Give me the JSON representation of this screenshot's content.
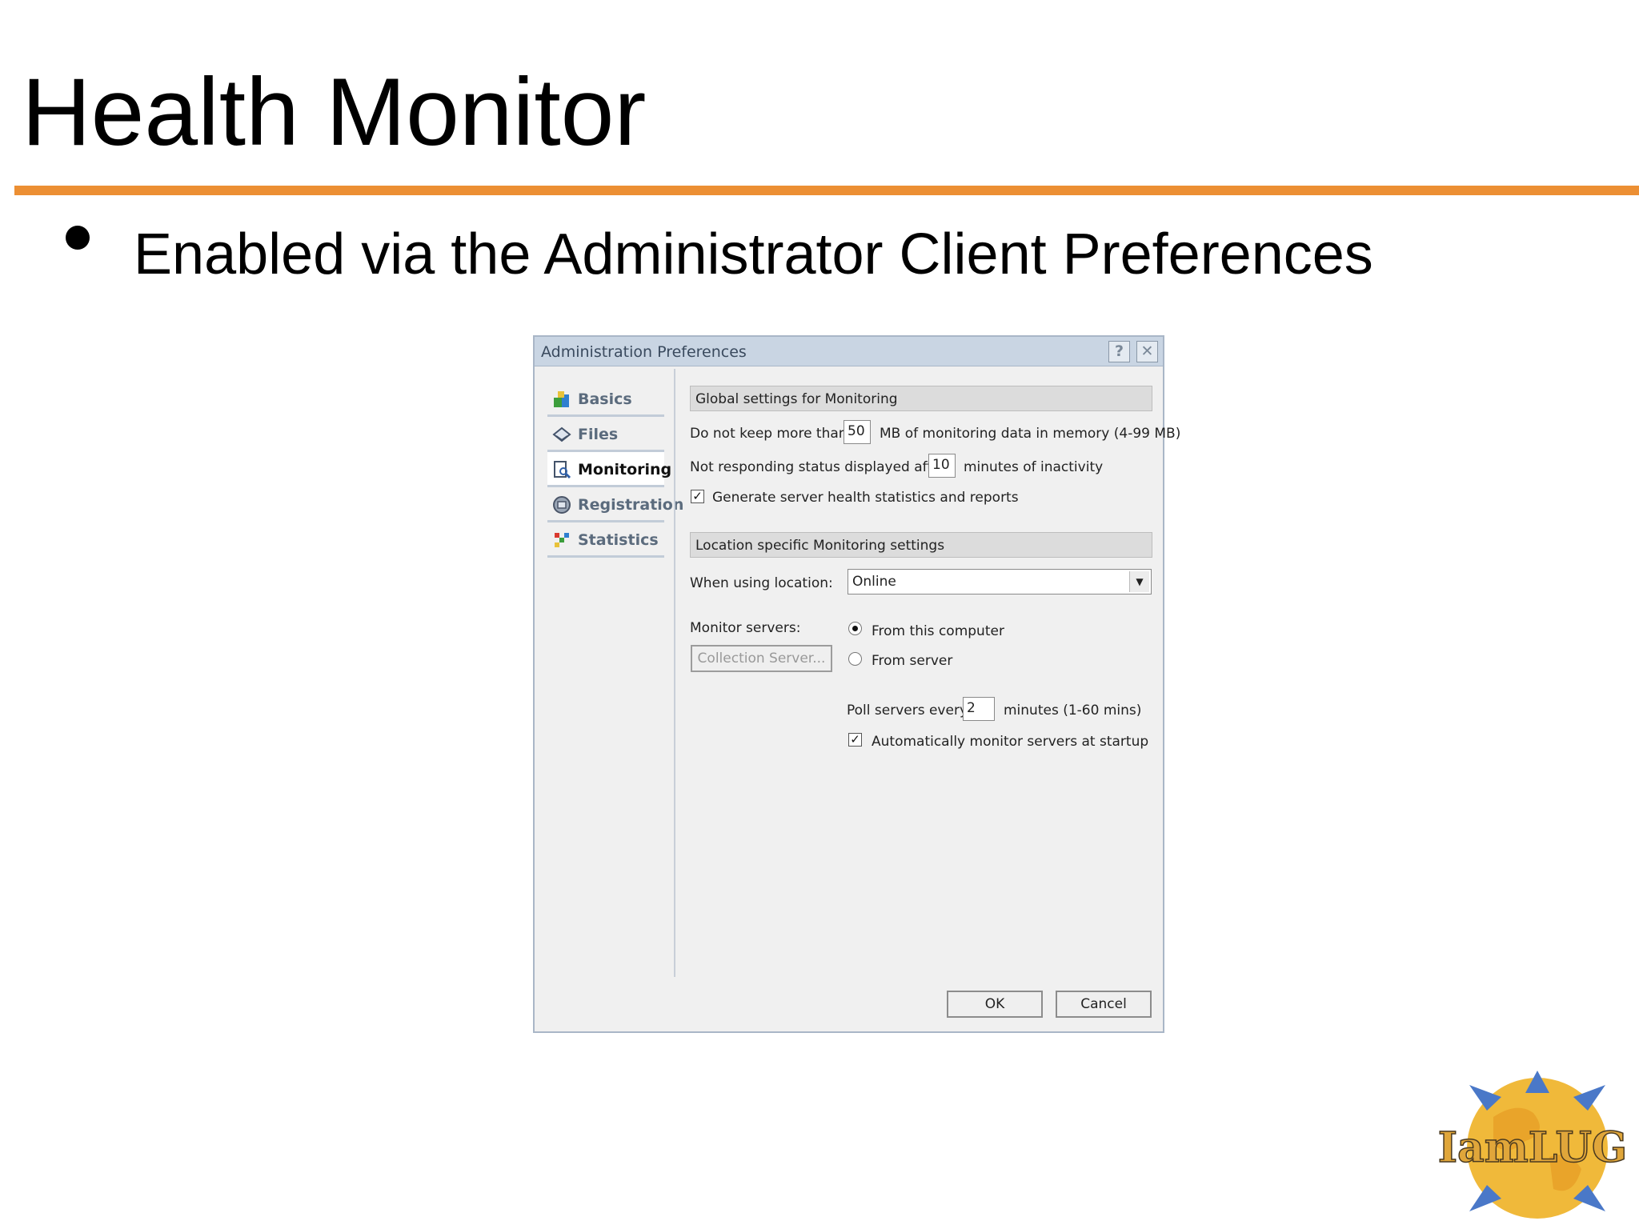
{
  "slide": {
    "title": "Health Monitor",
    "bullet": "Enabled via the Administrator Client Preferences"
  },
  "dialog": {
    "title": "Administration Preferences",
    "help_glyph": "?",
    "close_glyph": "✕",
    "nav": [
      {
        "label": "Basics",
        "icon": "basics-icon",
        "active": false
      },
      {
        "label": "Files",
        "icon": "files-icon",
        "active": false
      },
      {
        "label": "Monitoring",
        "icon": "monitoring-icon",
        "active": true
      },
      {
        "label": "Registration",
        "icon": "registration-icon",
        "active": false
      },
      {
        "label": "Statistics",
        "icon": "statistics-icon",
        "active": false
      }
    ],
    "global": {
      "header": "Global settings for Monitoring",
      "keep_prefix": "Do not keep more than",
      "keep_value": "50",
      "keep_suffix": "MB of monitoring data in memory (4-99 MB)",
      "notresp_prefix": "Not responding status displayed after",
      "notresp_value": "10",
      "notresp_suffix": "minutes of inactivity",
      "generate_label": "Generate server health statistics and reports",
      "generate_checked": true
    },
    "location": {
      "header": "Location specific Monitoring settings",
      "when_label": "When using location:",
      "location_value": "Online",
      "monitor_label": "Monitor servers:",
      "collection_button": "Collection Server...",
      "radio_this": "From this computer",
      "radio_server": "From server",
      "selected": "this",
      "poll_prefix": "Poll servers every",
      "poll_value": "2",
      "poll_suffix": "minutes (1-60 mins)",
      "auto_label": "Automatically monitor servers at startup",
      "auto_checked": true
    },
    "ok_label": "OK",
    "cancel_label": "Cancel"
  },
  "logo": {
    "text": "IamLUG"
  },
  "colors": {
    "accent_rule": "#ec8f33",
    "dialog_titlebar": "#c9d5e3",
    "logo_globe": "#f0b93a",
    "logo_arrows": "#4a78c8"
  }
}
